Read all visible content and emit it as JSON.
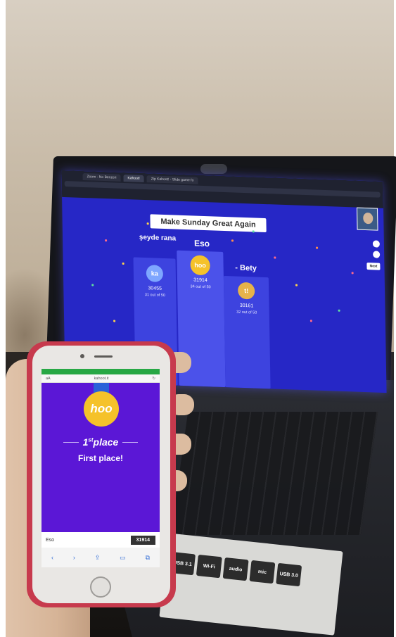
{
  "laptop_screen": {
    "browser_tabs": [
      "Zoom - No Benzeri",
      "Kahoot!",
      "Zip Kahoot! - Slide game fo"
    ],
    "banner_title": "Make Sunday Great Again",
    "next_label": "Next",
    "podium": [
      {
        "rank": 2,
        "name": "şeyde rana",
        "avatar": "ka",
        "score": "30455",
        "correct": "31 out of 50"
      },
      {
        "rank": 1,
        "name": "Eso",
        "avatar": "hoo",
        "score": "31914",
        "correct": "34 out of 50"
      },
      {
        "rank": 3,
        "name": "- Bety",
        "avatar": "t!",
        "score": "30161",
        "correct": "32 out of 50"
      }
    ]
  },
  "phone": {
    "url": "kahoot.it",
    "medal_text": "hoo",
    "place_ordinal": "1",
    "place_suffix": "st",
    "place_word": "place",
    "result_text": "First place!",
    "nickname": "Eso",
    "score": "31914"
  },
  "sticker": {
    "cells": [
      "USB 3.1",
      "Wi-Fi",
      "audio",
      "mic",
      "USB 3.0"
    ]
  },
  "colors": {
    "kahoot_blue": "#2627c6",
    "kahoot_purple": "#5b17d6",
    "medal_gold": "#f5c22a",
    "phone_case": "#c73a4d"
  }
}
